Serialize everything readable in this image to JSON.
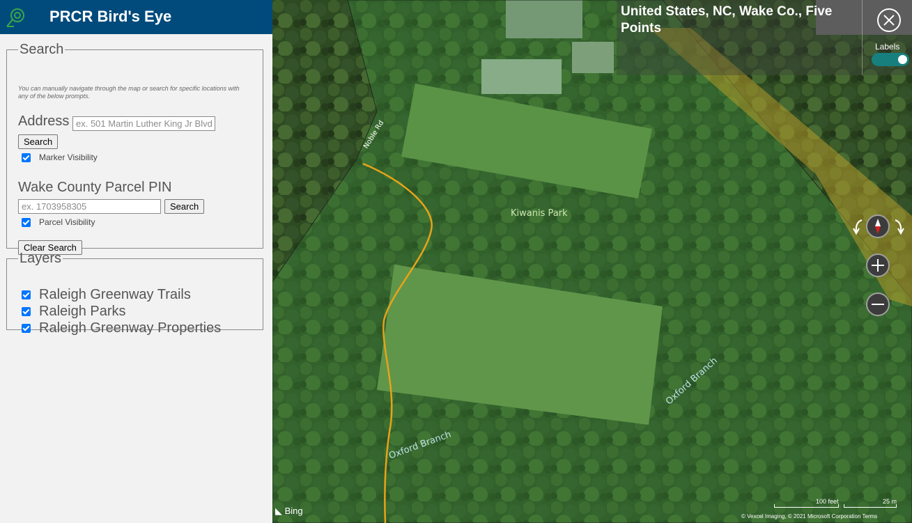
{
  "app": {
    "title": "PRCR Bird's Eye"
  },
  "search": {
    "legend": "Search",
    "hint": "You can manually navigate through the map or search for specific locations with any of the below prompts.",
    "address_label": "Address",
    "address_placeholder": "ex. 501 Martin Luther King Jr Blvd",
    "address_button": "Search",
    "marker_visibility_label": "Marker Visibility",
    "marker_visibility_checked": true,
    "pin_label": "Wake County Parcel PIN",
    "pin_placeholder": "ex. 1703958305",
    "pin_button": "Search",
    "parcel_visibility_label": "Parcel Visibility",
    "parcel_visibility_checked": true,
    "clear_button": "Clear Search"
  },
  "layers": {
    "legend": "Layers",
    "items": [
      {
        "label": "Raleigh Greenway Trails",
        "checked": true
      },
      {
        "label": "Raleigh Parks",
        "checked": true
      },
      {
        "label": "Raleigh Greenway Properties",
        "checked": true
      }
    ]
  },
  "map": {
    "location": "United States, NC, Wake Co., Five Points",
    "labels_toggle_label": "Labels",
    "labels_on": true,
    "place_labels": {
      "park": "Kiwanis Park",
      "road": "Noble Rd",
      "stream_1": "Oxford Branch",
      "stream_2": "Oxford Branch"
    },
    "bing_logo": "Bing",
    "scale_feet": "100 feet",
    "scale_m": "25 m",
    "copyright": "© Vexcel Imaging, © 2021 Microsoft Corporation Terms",
    "icons": [
      "close-icon",
      "rotate-left-icon",
      "compass-icon",
      "rotate-right-icon",
      "zoom-in-icon",
      "zoom-out-icon"
    ]
  },
  "colors": {
    "header": "#004b7c",
    "trail": "#e8a317",
    "park_overlay": "#3a8a3a",
    "toggle": "#17807e"
  }
}
